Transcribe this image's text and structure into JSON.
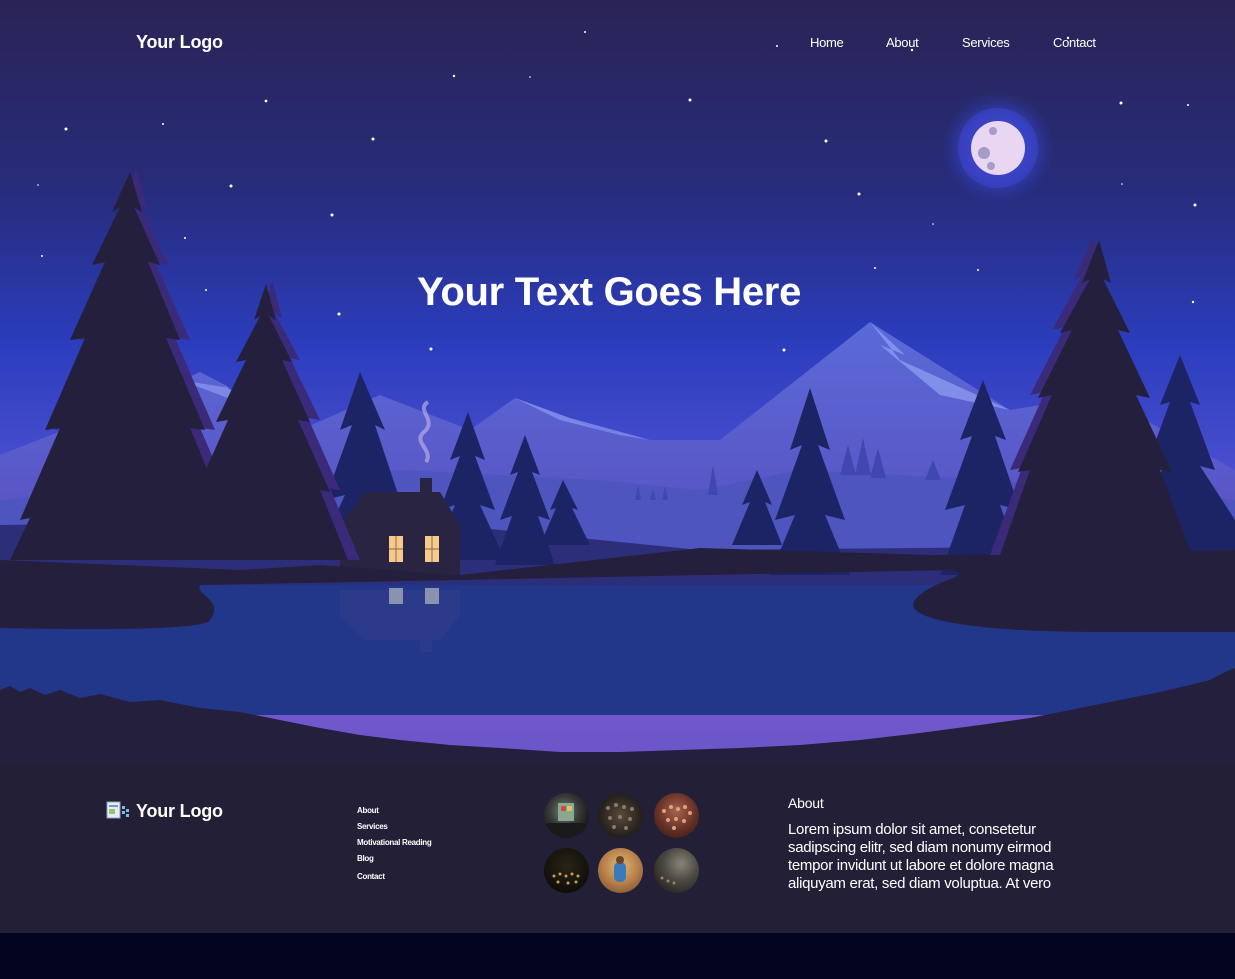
{
  "header": {
    "logo_text": "Your Logo",
    "nav": [
      {
        "label": "Home"
      },
      {
        "label": "About"
      },
      {
        "label": "Services"
      },
      {
        "label": "Contact"
      }
    ]
  },
  "hero": {
    "title": "Your Text Goes Here"
  },
  "footer": {
    "logo_text": "Your Logo",
    "links": [
      {
        "label": "About"
      },
      {
        "label": "Services"
      },
      {
        "label": "Motivational Reading"
      },
      {
        "label": "Blog"
      },
      {
        "label": "Contact"
      }
    ],
    "gallery_count": 6,
    "about": {
      "title": "About",
      "text": "Lorem ipsum dolor sit amet, consetetur sadipscing elitr, sed diam nonumy eirmod tempor invidunt ut labore et dolore magna aliquyam erat, sed diam voluptua. At vero"
    }
  },
  "colors": {
    "sky_top": "#2a2455",
    "sky_mid": "#2f3fbf",
    "sky_horizon": "#8a5fd6",
    "lake": "#22378a",
    "footer_bg": "#231f36",
    "bottom_strip": "#02031f",
    "moon": "#e8d6f2",
    "window_light": "#f7c98a"
  }
}
